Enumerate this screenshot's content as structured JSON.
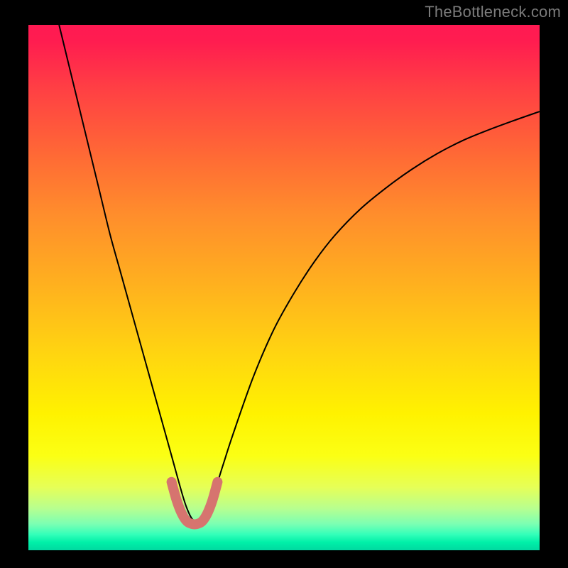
{
  "watermark": "TheBottleneck.com",
  "chart_data": {
    "type": "line",
    "title": "",
    "xlabel": "",
    "ylabel": "",
    "xlim": [
      0,
      100
    ],
    "ylim": [
      0,
      100
    ],
    "grid": false,
    "series": [
      {
        "name": "bottleneck-curve",
        "color": "#000000",
        "stroke_width": 2,
        "x": [
          6,
          8,
          10,
          12,
          14,
          16,
          18,
          20,
          22,
          24,
          26,
          28,
          30,
          31,
          32,
          33,
          34,
          36,
          38,
          40,
          44,
          48,
          52,
          56,
          60,
          65,
          70,
          75,
          80,
          85,
          90,
          95,
          100
        ],
        "y": [
          100,
          92,
          84,
          76,
          68,
          60,
          53,
          46,
          39,
          32,
          25,
          18,
          11,
          8,
          6,
          5.5,
          6,
          10,
          16,
          22,
          33,
          42,
          49,
          55,
          60,
          65,
          69,
          72.5,
          75.5,
          78,
          80,
          81.8,
          83.5
        ]
      },
      {
        "name": "optimal-zone-marker",
        "color": "#d6746f",
        "stroke_width": 14,
        "linecap": "round",
        "x": [
          28,
          29,
          30,
          31,
          32,
          33,
          34,
          35,
          36,
          37
        ],
        "y": [
          13,
          9.5,
          7,
          5.5,
          5,
          5,
          5.5,
          7,
          9.5,
          13
        ]
      }
    ]
  }
}
